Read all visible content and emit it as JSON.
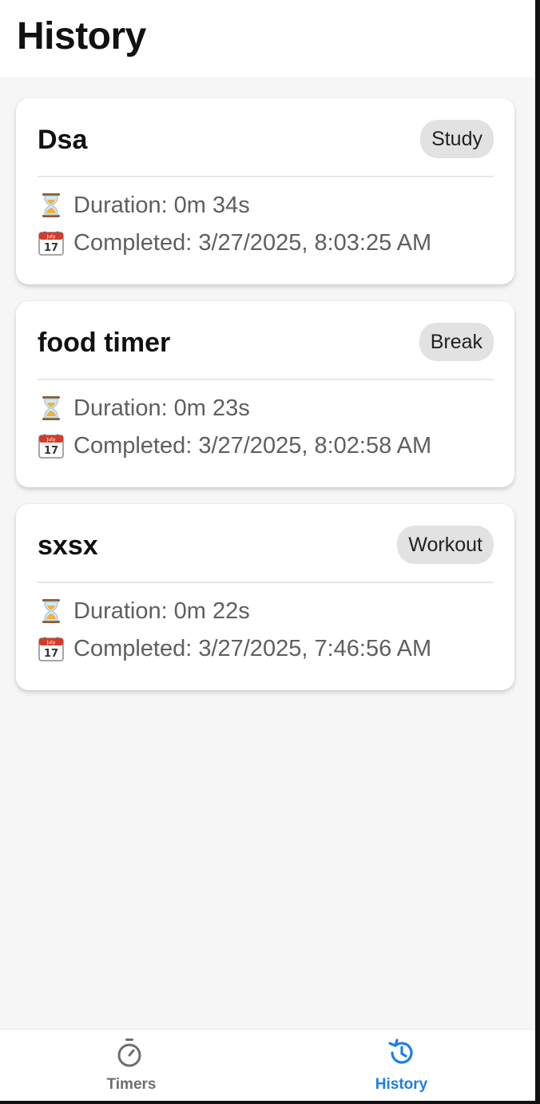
{
  "header": {
    "title": "History"
  },
  "history": [
    {
      "name": "Dsa",
      "category": "Study",
      "duration_label": "Duration:",
      "duration": "0m 34s",
      "completed_label": "Completed:",
      "completed": "3/27/2025, 8:03:25 AM"
    },
    {
      "name": "food timer",
      "category": "Break",
      "duration_label": "Duration:",
      "duration": "0m 23s",
      "completed_label": "Completed:",
      "completed": "3/27/2025, 8:02:58 AM"
    },
    {
      "name": "sxsx",
      "category": "Workout",
      "duration_label": "Duration:",
      "duration": "0m 22s",
      "completed_label": "Completed:",
      "completed": "3/27/2025, 7:46:56 AM"
    }
  ],
  "icons": {
    "duration": "hourglass-icon",
    "completed": "calendar-icon",
    "calendar_month": "July",
    "calendar_day": "17"
  },
  "tabs": [
    {
      "label": "Timers",
      "icon": "stopwatch-icon",
      "active": false
    },
    {
      "label": "History",
      "icon": "history-icon",
      "active": true
    }
  ],
  "colors": {
    "accent": "#1e7ee6",
    "inactive": "#6e6e6e",
    "background": "#f6f6f6",
    "badge": "#e2e2e2"
  }
}
